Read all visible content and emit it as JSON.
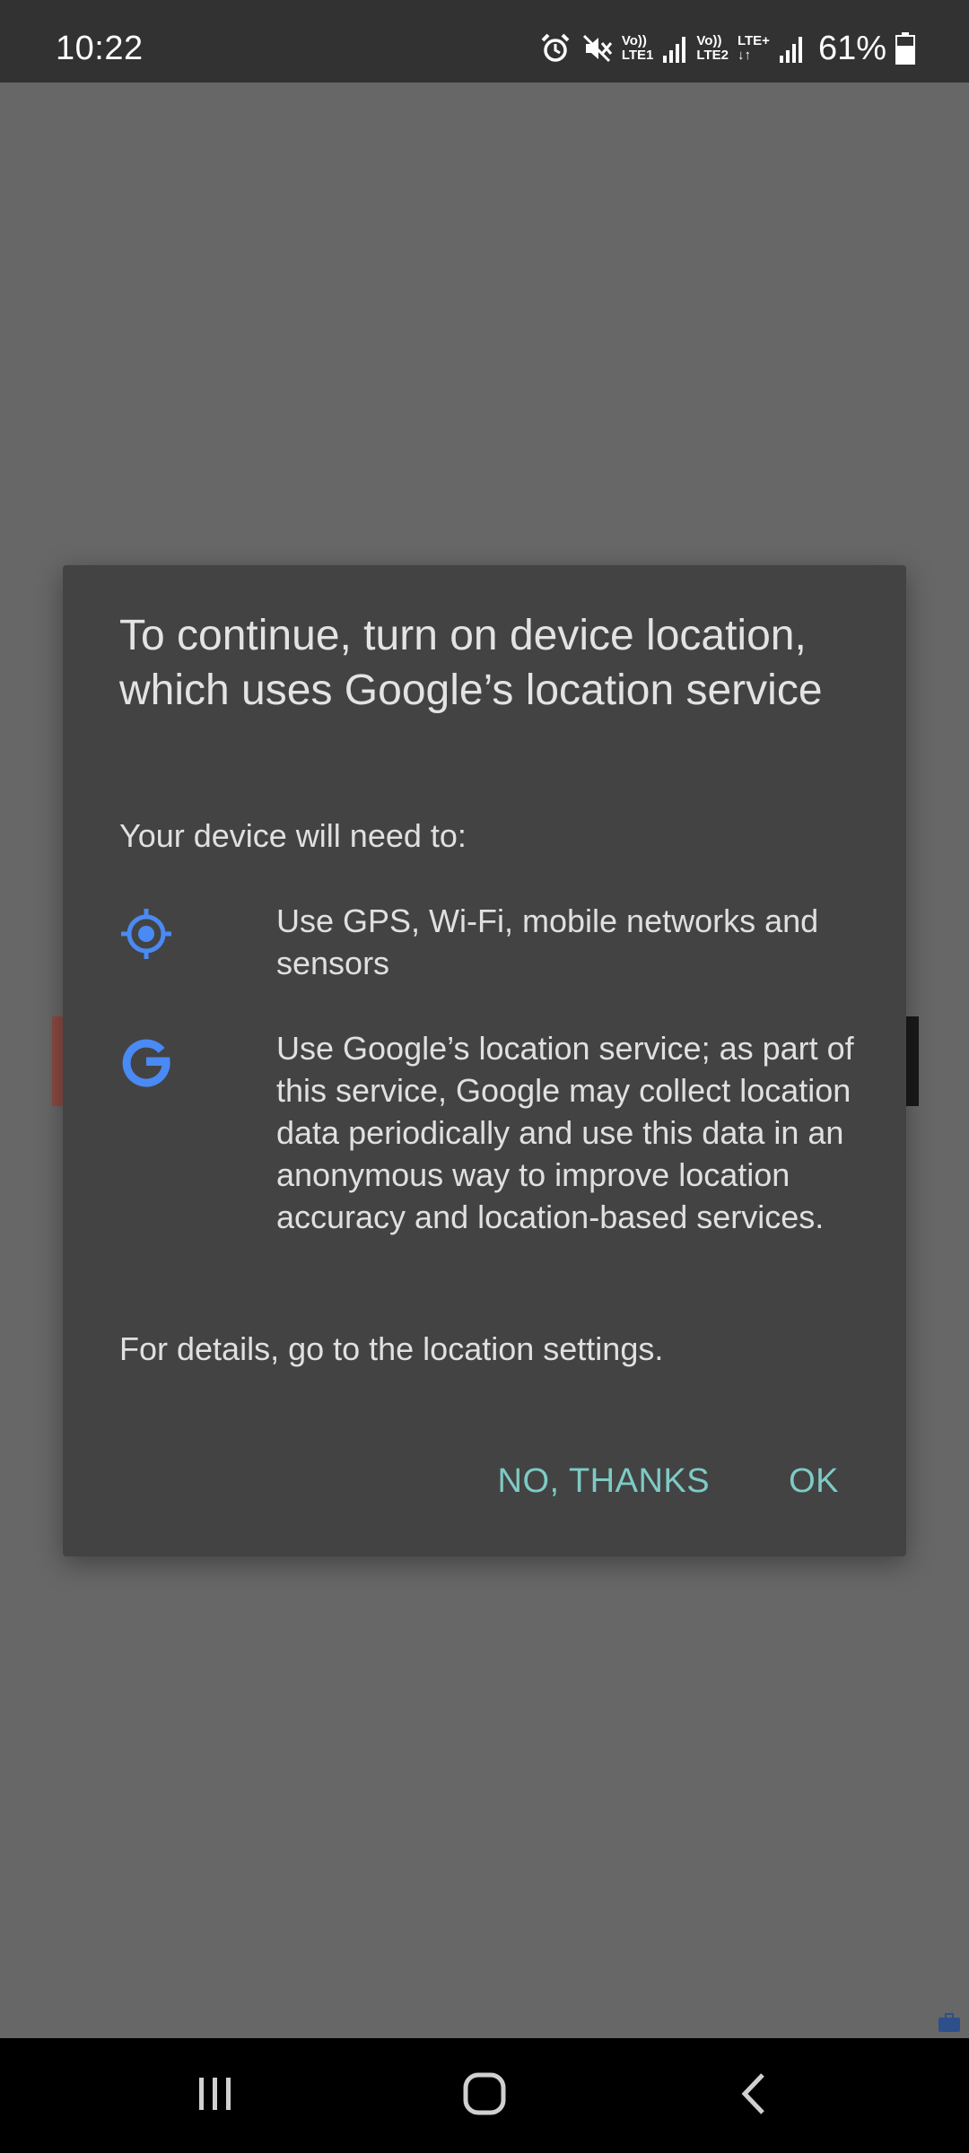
{
  "status_bar": {
    "time": "10:22",
    "sim1_label_top": "Vo))",
    "sim1_label_bottom": "LTE1",
    "sim2_label_top": "Vo))",
    "sim2_label_bottom": "LTE2",
    "lte_plus": "LTE+",
    "battery": "61%",
    "icons": [
      "alarm-icon",
      "mute-icon",
      "signal-icon",
      "battery-icon"
    ]
  },
  "dialog": {
    "title": "To continue, turn on device location, which uses Google’s location service",
    "subtitle": "Your device will need to:",
    "items": [
      {
        "icon": "gps-target-icon",
        "text": "Use GPS, Wi-Fi, mobile networks and sensors"
      },
      {
        "icon": "google-g-icon",
        "text": "Use Google’s location service; as part of this service, Google may collect location data periodically and use this data in an anonymous way to improve location accuracy and location-based services."
      }
    ],
    "footer": "For details, go to the location settings.",
    "buttons": {
      "negative": "NO, THANKS",
      "positive": "OK"
    },
    "accent_color": "#7ecbc5",
    "icon_color": "#4a8af4"
  },
  "nav_bar": {
    "icons": [
      "recents-icon",
      "home-icon",
      "back-icon"
    ]
  }
}
